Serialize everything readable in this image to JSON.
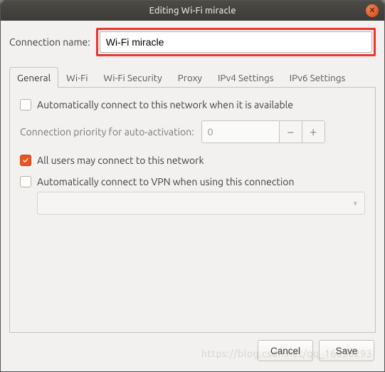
{
  "window": {
    "title": "Editing Wi-Fi miracle"
  },
  "connection_name": {
    "label": "Connection name:",
    "value": "Wi-Fi miracle"
  },
  "tabs": {
    "general": "General",
    "wifi": "Wi-Fi",
    "wifi_security": "Wi-Fi Security",
    "proxy": "Proxy",
    "ipv4": "IPv4 Settings",
    "ipv6": "IPv6 Settings",
    "active": "general"
  },
  "general_panel": {
    "auto_connect": {
      "label": "Automatically connect to this network when it is available",
      "checked": false
    },
    "priority": {
      "label": "Connection priority for auto-activation:",
      "value": "0"
    },
    "all_users": {
      "label": "All users may connect to this network",
      "checked": true
    },
    "auto_vpn": {
      "label": "Automatically connect to VPN when using this connection",
      "checked": false
    },
    "vpn_dropdown": {
      "value": ""
    }
  },
  "buttons": {
    "cancel": "Cancel",
    "save": "Save"
  },
  "watermark": "https://blog.csdn.net/qq_16836293"
}
